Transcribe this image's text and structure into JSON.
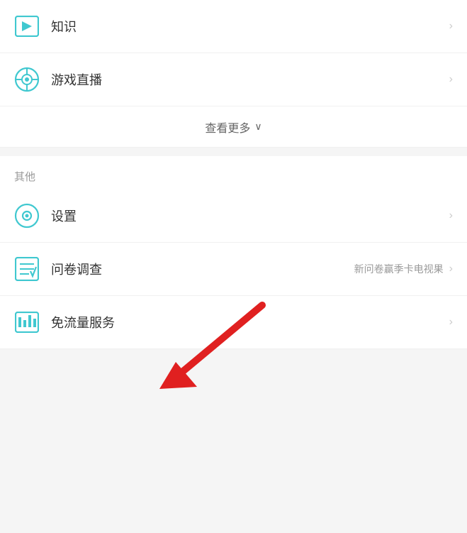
{
  "menu": {
    "items_top": [
      {
        "id": "knowledge",
        "label": "知识",
        "icon": "knowledge-icon",
        "has_chevron": true,
        "badge": ""
      },
      {
        "id": "game-live",
        "label": "游戏直播",
        "icon": "game-icon",
        "has_chevron": true,
        "badge": ""
      }
    ],
    "see_more": {
      "label": "查看更多",
      "chevron": "∨"
    },
    "section_other": {
      "title": "其他"
    },
    "items_other": [
      {
        "id": "settings",
        "label": "设置",
        "icon": "settings-icon",
        "has_chevron": true,
        "badge": ""
      },
      {
        "id": "survey",
        "label": "问卷调查",
        "icon": "survey-icon",
        "has_chevron": true,
        "badge": "新问卷赢季卡电视果"
      },
      {
        "id": "free-flow",
        "label": "免流量服务",
        "icon": "free-flow-icon",
        "has_chevron": true,
        "badge": ""
      }
    ]
  },
  "colors": {
    "teal": "#40c8d0",
    "arrow_red": "#e02020"
  }
}
